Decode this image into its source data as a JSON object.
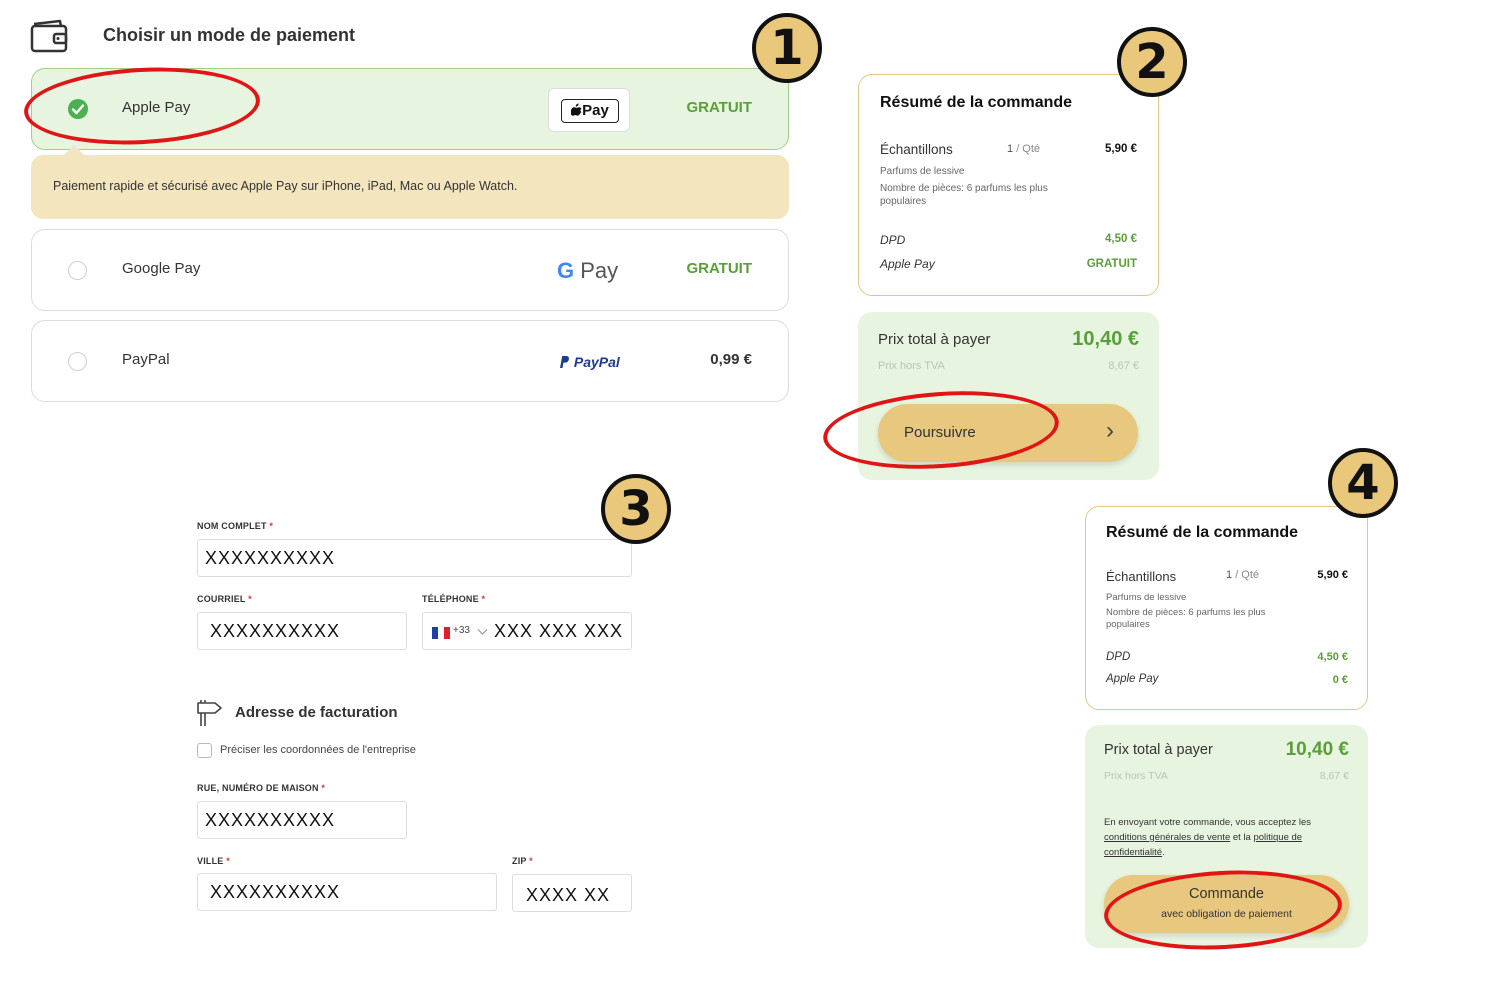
{
  "payment": {
    "title": "Choisir un mode de paiement",
    "options": [
      {
        "label": "Apple Pay",
        "price": "GRATUIT",
        "logo_text": "Pay"
      },
      {
        "label": "Google Pay",
        "price": "GRATUIT",
        "logo_g": "G",
        "logo_text": "Pay"
      },
      {
        "label": "PayPal",
        "price": "0,99 €",
        "logo_text": "PayPal"
      }
    ],
    "info": "Paiement rapide et sécurisé avec Apple Pay sur iPhone, iPad, Mac ou Apple Watch."
  },
  "summary1": {
    "title": "Résumé de la commande",
    "item": "Échantillons",
    "qty": "1",
    "qty_unit": "/ Qté",
    "price": "5,90 €",
    "sub1": "Parfums de lessive",
    "sub2": "Nombre de pièces: 6 parfums les plus populaires",
    "ship_label": "DPD",
    "ship_price": "4,50 €",
    "pay_label": "Apple Pay",
    "pay_price": "GRATUIT"
  },
  "total1": {
    "label": "Prix total à payer",
    "value": "10,40 €",
    "ht_label": "Prix hors TVA",
    "ht_value": "8,67 €",
    "button": "Poursuivre",
    "chevron": "›"
  },
  "form": {
    "name_label": "NOM COMPLET",
    "name_value": "XXXXXXXXXX",
    "email_label": "COURRIEL",
    "email_value": "XXXXXXXXXX",
    "phone_label": "TÉLÉPHONE",
    "phone_prefix": "+33",
    "phone_value": "XXX XXX XXX",
    "required": "*",
    "billing_title": "Adresse de facturation",
    "company_check": "Préciser les coordonnées de l'entreprise",
    "street_label": "RUE, NUMÉRO DE MAISON",
    "street_value": "XXXXXXXXXX",
    "city_label": "VILLE",
    "city_value": "XXXXXXXXXX",
    "zip_label": "ZIP",
    "zip_value": "XXXX XX"
  },
  "summary2": {
    "title": "Résumé de la commande",
    "item": "Échantillons",
    "qty": "1",
    "qty_unit": "/ Qté",
    "price": "5,90 €",
    "sub1": "Parfums de lessive",
    "sub2": "Nombre de pièces: 6 parfums les plus populaires",
    "ship_label": "DPD",
    "ship_price": "4,50 €",
    "pay_label": "Apple Pay",
    "pay_price": "0 €"
  },
  "total2": {
    "label": "Prix total à payer",
    "value": "10,40 €",
    "ht_label": "Prix hors TVA",
    "ht_value": "8,67 €",
    "legal_1": "En envoyant votre commande, vous acceptez les",
    "legal_link1": "conditions générales de vente",
    "legal_and": "et la",
    "legal_link2": "politique de confidentialité",
    "legal_end": ".",
    "button_main": "Commande",
    "button_sub": "avec obligation de paiement"
  },
  "badges": [
    "1",
    "2",
    "3",
    "4"
  ],
  "colors": {
    "green": "#5a9e3a",
    "gold": "#e8c77e",
    "light_green": "#e7f4df",
    "red_annotation": "#e01515"
  }
}
